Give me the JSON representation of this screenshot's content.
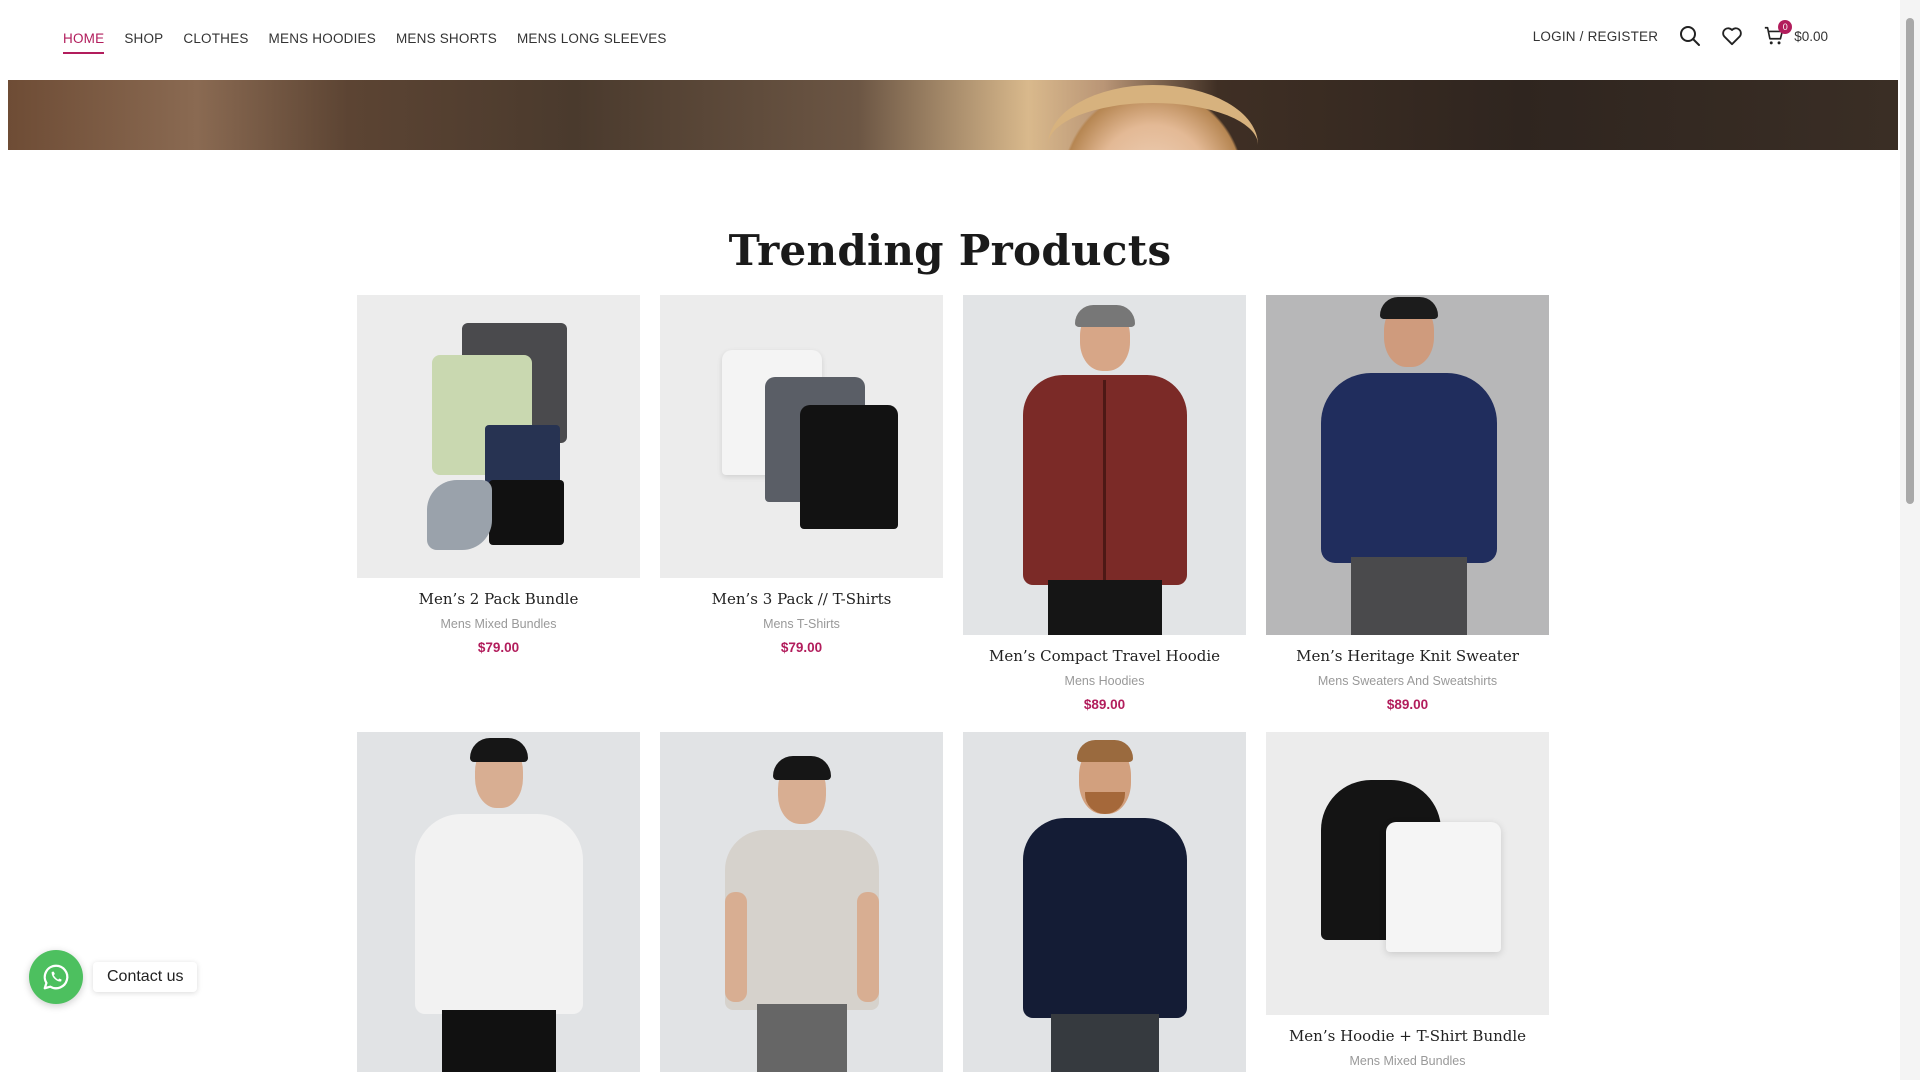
{
  "nav": {
    "items": [
      {
        "label": "HOME",
        "active": true
      },
      {
        "label": "SHOP",
        "active": false
      },
      {
        "label": "CLOTHES",
        "active": false
      },
      {
        "label": "MENS HOODIES",
        "active": false
      },
      {
        "label": "MENS SHORTS",
        "active": false
      },
      {
        "label": "MENS LONG SLEEVES",
        "active": false
      }
    ],
    "login_label": "LOGIN / REGISTER",
    "cart_count": "0",
    "cart_total": "$0.00",
    "icons": [
      "search-icon",
      "heart-icon",
      "cart-icon"
    ]
  },
  "section": {
    "title": "Trending Products"
  },
  "products": [
    {
      "name": "Men’s 2 Pack Bundle",
      "category": "Mens Mixed Bundles",
      "price": "$79.00"
    },
    {
      "name": "Men’s 3 Pack // T-Shirts",
      "category": "Mens T-Shirts",
      "price": "$79.00"
    },
    {
      "name": "Men’s Compact Travel Hoodie",
      "category": "Mens Hoodies",
      "price": "$89.00"
    },
    {
      "name": "Men’s Heritage Knit Sweater",
      "category": "Mens Sweaters And Sweatshirts",
      "price": "$89.00"
    },
    {
      "name": "",
      "category": "",
      "price": ""
    },
    {
      "name": "",
      "category": "",
      "price": ""
    },
    {
      "name": "",
      "category": "",
      "price": ""
    },
    {
      "name": "Men’s Hoodie + T-Shirt Bundle",
      "category": "Mens Mixed Bundles",
      "price": ""
    }
  ],
  "contact": {
    "label": "Contact us"
  },
  "colors": {
    "accent": "#b21d5c",
    "whatsapp": "#4dc05f"
  }
}
